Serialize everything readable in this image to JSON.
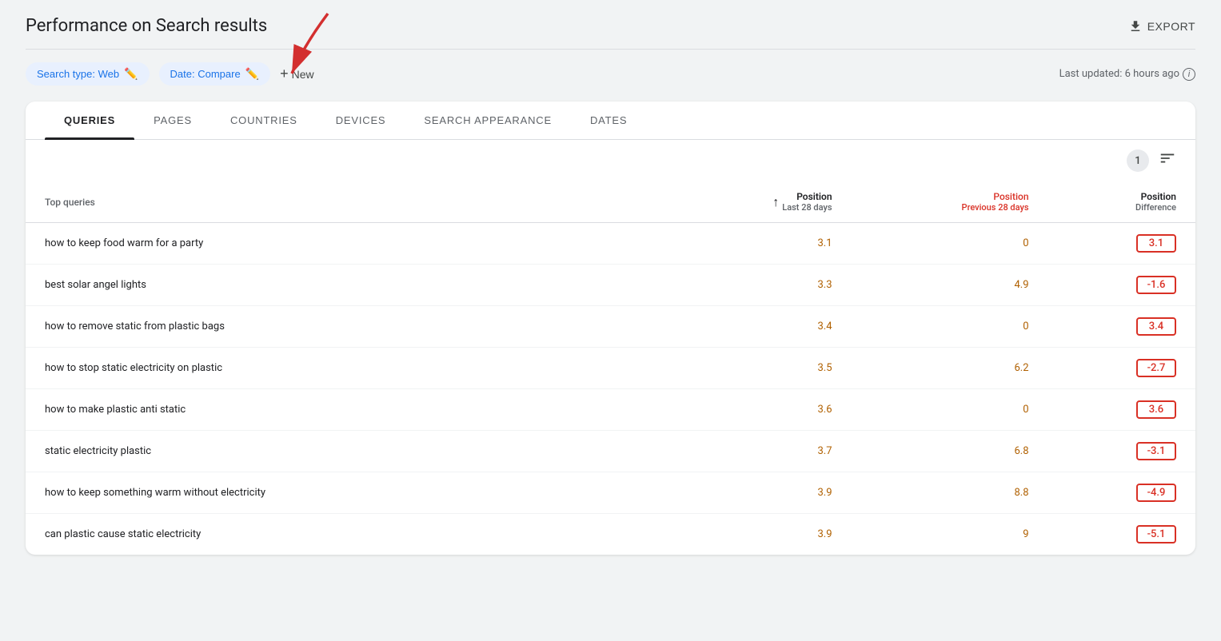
{
  "header": {
    "title": "Performance on Search results",
    "export_label": "EXPORT"
  },
  "filters": {
    "search_type_label": "Search type: Web",
    "date_label": "Date: Compare",
    "new_label": "New",
    "last_updated": "Last updated: 6 hours ago"
  },
  "tabs": [
    {
      "label": "QUERIES",
      "active": true
    },
    {
      "label": "PAGES",
      "active": false
    },
    {
      "label": "COUNTRIES",
      "active": false
    },
    {
      "label": "DEVICES",
      "active": false
    },
    {
      "label": "SEARCH APPEARANCE",
      "active": false
    },
    {
      "label": "DATES",
      "active": false
    }
  ],
  "table": {
    "top_queries_label": "Top queries",
    "badge_count": "1",
    "columns": [
      {
        "label": "Position",
        "sublabel": "Last 28 days",
        "type": "numeric",
        "sorted": true
      },
      {
        "label": "Position",
        "sublabel": "Previous 28 days",
        "type": "numeric",
        "is_prev": true
      },
      {
        "label": "Position",
        "sublabel": "Difference",
        "type": "numeric"
      }
    ],
    "rows": [
      {
        "query": "how to keep food warm for a party",
        "position": "3.1",
        "prev_position": "0",
        "difference": "3.1"
      },
      {
        "query": "best solar angel lights",
        "position": "3.3",
        "prev_position": "4.9",
        "difference": "-1.6"
      },
      {
        "query": "how to remove static from plastic bags",
        "position": "3.4",
        "prev_position": "0",
        "difference": "3.4"
      },
      {
        "query": "how to stop static electricity on plastic",
        "position": "3.5",
        "prev_position": "6.2",
        "difference": "-2.7"
      },
      {
        "query": "how to make plastic anti static",
        "position": "3.6",
        "prev_position": "0",
        "difference": "3.6"
      },
      {
        "query": "static electricity plastic",
        "position": "3.7",
        "prev_position": "6.8",
        "difference": "-3.1"
      },
      {
        "query": "how to keep something warm without electricity",
        "position": "3.9",
        "prev_position": "8.8",
        "difference": "-4.9"
      },
      {
        "query": "can plastic cause static electricity",
        "position": "3.9",
        "prev_position": "9",
        "difference": "-5.1"
      }
    ]
  }
}
